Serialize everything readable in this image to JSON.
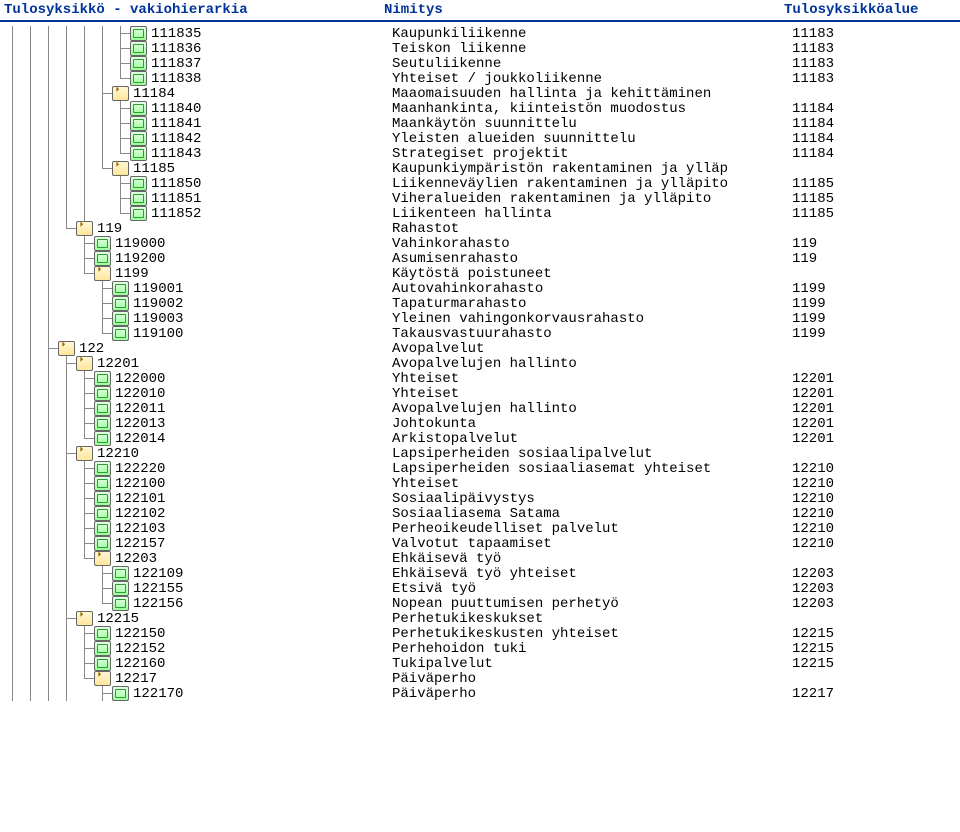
{
  "header": {
    "col1": "Tulosyksikkö - vakiohierarkia",
    "col2": "Nimitys",
    "col3": "Tulosyksikköalue"
  },
  "rows": [
    {
      "d": 7,
      "c": [
        "v",
        "v",
        "v",
        "v",
        "v",
        "v",
        "t"
      ],
      "i": "leaf",
      "code": "111835",
      "label": "Kaupunkiliikenne",
      "area": "11183"
    },
    {
      "d": 7,
      "c": [
        "v",
        "v",
        "v",
        "v",
        "v",
        "v",
        "t"
      ],
      "i": "leaf",
      "code": "111836",
      "label": "Teiskon liikenne",
      "area": "11183"
    },
    {
      "d": 7,
      "c": [
        "v",
        "v",
        "v",
        "v",
        "v",
        "v",
        "t"
      ],
      "i": "leaf",
      "code": "111837",
      "label": "Seutuliikenne",
      "area": "11183"
    },
    {
      "d": 7,
      "c": [
        "v",
        "v",
        "v",
        "v",
        "v",
        "v",
        "l"
      ],
      "i": "leaf",
      "code": "111838",
      "label": "Yhteiset / joukkoliikenne",
      "area": "11183"
    },
    {
      "d": 6,
      "c": [
        "v",
        "v",
        "v",
        "v",
        "v",
        "t"
      ],
      "i": "folder",
      "code": "11184",
      "label": "Maaomaisuuden hallinta ja kehittäminen",
      "area": ""
    },
    {
      "d": 7,
      "c": [
        "v",
        "v",
        "v",
        "v",
        "v",
        "v",
        "t"
      ],
      "i": "leaf",
      "code": "111840",
      "label": "Maanhankinta, kiinteistön muodostus",
      "area": "11184"
    },
    {
      "d": 7,
      "c": [
        "v",
        "v",
        "v",
        "v",
        "v",
        "v",
        "t"
      ],
      "i": "leaf",
      "code": "111841",
      "label": "Maankäytön suunnittelu",
      "area": "11184"
    },
    {
      "d": 7,
      "c": [
        "v",
        "v",
        "v",
        "v",
        "v",
        "v",
        "t"
      ],
      "i": "leaf",
      "code": "111842",
      "label": "Yleisten alueiden suunnittelu",
      "area": "11184"
    },
    {
      "d": 7,
      "c": [
        "v",
        "v",
        "v",
        "v",
        "v",
        "v",
        "l"
      ],
      "i": "leaf",
      "code": "111843",
      "label": "Strategiset projektit",
      "area": "11184"
    },
    {
      "d": 6,
      "c": [
        "v",
        "v",
        "v",
        "v",
        "v",
        "l"
      ],
      "i": "folder",
      "code": "11185",
      "label": "Kaupunkiympäristön rakentaminen ja ylläp",
      "area": ""
    },
    {
      "d": 7,
      "c": [
        "v",
        "v",
        "v",
        "v",
        "v",
        "b",
        "t"
      ],
      "i": "leaf",
      "code": "111850",
      "label": "Liikenneväylien rakentaminen ja ylläpito",
      "area": "11185"
    },
    {
      "d": 7,
      "c": [
        "v",
        "v",
        "v",
        "v",
        "v",
        "b",
        "t"
      ],
      "i": "leaf",
      "code": "111851",
      "label": "Viheralueiden rakentaminen ja ylläpito",
      "area": "11185"
    },
    {
      "d": 7,
      "c": [
        "v",
        "v",
        "v",
        "v",
        "v",
        "b",
        "l"
      ],
      "i": "leaf",
      "code": "111852",
      "label": "Liikenteen hallinta",
      "area": "11185"
    },
    {
      "d": 4,
      "c": [
        "v",
        "v",
        "v",
        "l"
      ],
      "i": "folder",
      "code": "119",
      "label": "Rahastot",
      "area": ""
    },
    {
      "d": 5,
      "c": [
        "v",
        "v",
        "v",
        "b",
        "t"
      ],
      "i": "leaf",
      "code": "119000",
      "label": "Vahinkorahasto",
      "area": "119"
    },
    {
      "d": 5,
      "c": [
        "v",
        "v",
        "v",
        "b",
        "t"
      ],
      "i": "leaf",
      "code": "119200",
      "label": "Asumisenrahasto",
      "area": "119"
    },
    {
      "d": 5,
      "c": [
        "v",
        "v",
        "v",
        "b",
        "l"
      ],
      "i": "folder",
      "code": "1199",
      "label": "Käytöstä poistuneet",
      "area": ""
    },
    {
      "d": 6,
      "c": [
        "v",
        "v",
        "v",
        "b",
        "b",
        "t"
      ],
      "i": "leaf",
      "code": "119001",
      "label": "Autovahinkorahasto",
      "area": "1199"
    },
    {
      "d": 6,
      "c": [
        "v",
        "v",
        "v",
        "b",
        "b",
        "t"
      ],
      "i": "leaf",
      "code": "119002",
      "label": "Tapaturmarahasto",
      "area": "1199"
    },
    {
      "d": 6,
      "c": [
        "v",
        "v",
        "v",
        "b",
        "b",
        "t"
      ],
      "i": "leaf",
      "code": "119003",
      "label": "Yleinen vahingonkorvausrahasto",
      "area": "1199"
    },
    {
      "d": 6,
      "c": [
        "v",
        "v",
        "v",
        "b",
        "b",
        "l"
      ],
      "i": "leaf",
      "code": "119100",
      "label": "Takausvastuurahasto",
      "area": "1199"
    },
    {
      "d": 3,
      "c": [
        "v",
        "v",
        "t"
      ],
      "i": "folder",
      "code": "122",
      "label": "Avopalvelut",
      "area": ""
    },
    {
      "d": 4,
      "c": [
        "v",
        "v",
        "v",
        "t"
      ],
      "i": "folder",
      "code": "12201",
      "label": "Avopalvelujen hallinto",
      "area": ""
    },
    {
      "d": 5,
      "c": [
        "v",
        "v",
        "v",
        "v",
        "t"
      ],
      "i": "leaf",
      "code": "122000",
      "label": "Yhteiset",
      "area": "12201"
    },
    {
      "d": 5,
      "c": [
        "v",
        "v",
        "v",
        "v",
        "t"
      ],
      "i": "leaf",
      "code": "122010",
      "label": "Yhteiset",
      "area": "12201"
    },
    {
      "d": 5,
      "c": [
        "v",
        "v",
        "v",
        "v",
        "t"
      ],
      "i": "leaf",
      "code": "122011",
      "label": "Avopalvelujen hallinto",
      "area": "12201"
    },
    {
      "d": 5,
      "c": [
        "v",
        "v",
        "v",
        "v",
        "t"
      ],
      "i": "leaf",
      "code": "122013",
      "label": "Johtokunta",
      "area": "12201"
    },
    {
      "d": 5,
      "c": [
        "v",
        "v",
        "v",
        "v",
        "l"
      ],
      "i": "leaf",
      "code": "122014",
      "label": "Arkistopalvelut",
      "area": "12201"
    },
    {
      "d": 4,
      "c": [
        "v",
        "v",
        "v",
        "t"
      ],
      "i": "folder",
      "code": "12210",
      "label": "Lapsiperheiden sosiaalipalvelut",
      "area": ""
    },
    {
      "d": 5,
      "c": [
        "v",
        "v",
        "v",
        "v",
        "t"
      ],
      "i": "leaf",
      "code": "122220",
      "label": "Lapsiperheiden sosiaaliasemat yhteiset",
      "area": "12210"
    },
    {
      "d": 5,
      "c": [
        "v",
        "v",
        "v",
        "v",
        "t"
      ],
      "i": "leaf",
      "code": "122100",
      "label": "Yhteiset",
      "area": "12210"
    },
    {
      "d": 5,
      "c": [
        "v",
        "v",
        "v",
        "v",
        "t"
      ],
      "i": "leaf",
      "code": "122101",
      "label": "Sosiaalipäivystys",
      "area": "12210"
    },
    {
      "d": 5,
      "c": [
        "v",
        "v",
        "v",
        "v",
        "t"
      ],
      "i": "leaf",
      "code": "122102",
      "label": "Sosiaaliasema Satama",
      "area": "12210"
    },
    {
      "d": 5,
      "c": [
        "v",
        "v",
        "v",
        "v",
        "t"
      ],
      "i": "leaf",
      "code": "122103",
      "label": "Perheoikeudelliset palvelut",
      "area": "12210"
    },
    {
      "d": 5,
      "c": [
        "v",
        "v",
        "v",
        "v",
        "t"
      ],
      "i": "leaf",
      "code": "122157",
      "label": "Valvotut tapaamiset",
      "area": "12210"
    },
    {
      "d": 5,
      "c": [
        "v",
        "v",
        "v",
        "v",
        "l"
      ],
      "i": "folder",
      "code": "12203",
      "label": "Ehkäisevä työ",
      "area": ""
    },
    {
      "d": 6,
      "c": [
        "v",
        "v",
        "v",
        "v",
        "b",
        "t"
      ],
      "i": "leaf",
      "code": "122109",
      "label": "Ehkäisevä työ yhteiset",
      "area": "12203"
    },
    {
      "d": 6,
      "c": [
        "v",
        "v",
        "v",
        "v",
        "b",
        "t"
      ],
      "i": "leaf",
      "code": "122155",
      "label": "Etsivä työ",
      "area": "12203"
    },
    {
      "d": 6,
      "c": [
        "v",
        "v",
        "v",
        "v",
        "b",
        "l"
      ],
      "i": "leaf",
      "code": "122156",
      "label": "Nopean puuttumisen perhetyö",
      "area": "12203"
    },
    {
      "d": 4,
      "c": [
        "v",
        "v",
        "v",
        "t"
      ],
      "i": "folder",
      "code": "12215",
      "label": "Perhetukikeskukset",
      "area": ""
    },
    {
      "d": 5,
      "c": [
        "v",
        "v",
        "v",
        "v",
        "t"
      ],
      "i": "leaf",
      "code": "122150",
      "label": "Perhetukikeskusten yhteiset",
      "area": "12215"
    },
    {
      "d": 5,
      "c": [
        "v",
        "v",
        "v",
        "v",
        "t"
      ],
      "i": "leaf",
      "code": "122152",
      "label": "Perhehoidon tuki",
      "area": "12215"
    },
    {
      "d": 5,
      "c": [
        "v",
        "v",
        "v",
        "v",
        "t"
      ],
      "i": "leaf",
      "code": "122160",
      "label": "Tukipalvelut",
      "area": "12215"
    },
    {
      "d": 5,
      "c": [
        "v",
        "v",
        "v",
        "v",
        "l"
      ],
      "i": "folder",
      "code": "12217",
      "label": "Päiväperho",
      "area": ""
    },
    {
      "d": 6,
      "c": [
        "v",
        "v",
        "v",
        "v",
        "b",
        "t"
      ],
      "i": "leaf",
      "code": "122170",
      "label": "Päiväperho",
      "area": "12217"
    }
  ]
}
